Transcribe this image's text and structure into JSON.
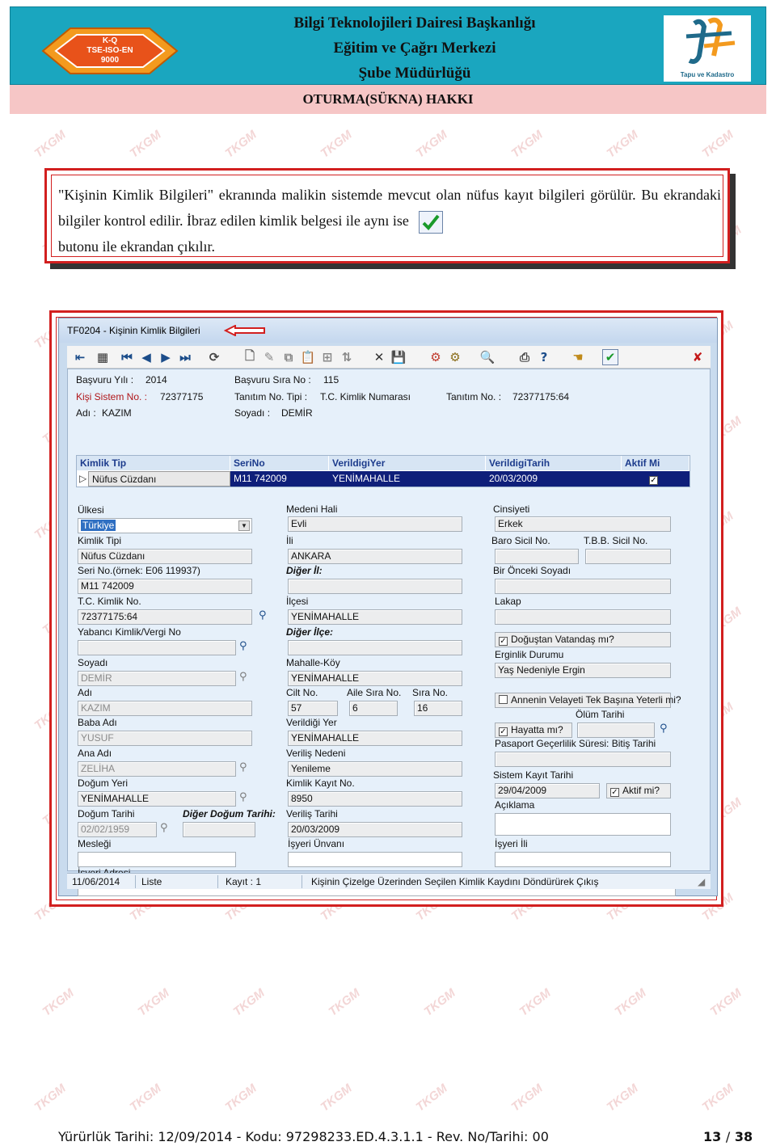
{
  "header": {
    "logo_lines": [
      "K-Q",
      "TSE-ISO-EN",
      "9000"
    ],
    "title_lines": [
      "Bilgi Teknolojileri Dairesi Başkanlığı",
      "Eğitim ve Çağrı Merkezi",
      "Şube Müdürlüğü"
    ],
    "tk_logo_caption": "Tapu ve Kadastro",
    "section_title": "OTURMA(SÜKNA) HAKKI"
  },
  "watermark_text": "TKGM",
  "info": {
    "text_before": "\"Kişinin Kimlik Bilgileri\" ekranında malikin sistemde mevcut olan nüfus kayıt bilgileri görülür. Bu ekrandaki bilgiler kontrol edilir. İbraz edilen kimlik belgesi ile aynı ise",
    "text_after": "butonu ile ekrandan çıkılır."
  },
  "window": {
    "title": "TF0204 - Kişinin Kimlik Bilgileri",
    "summary": {
      "basvuru_yili_label": "Başvuru Yılı :",
      "basvuru_yili": "2014",
      "basvuru_sira_label": "Başvuru Sıra No :",
      "basvuru_sira": "115",
      "kisi_sistem_label": "Kişi Sistem No. :",
      "kisi_sistem": "72377175",
      "tanitim_tipi_label": "Tanıtım No. Tipi :",
      "tanitim_tipi": "T.C. Kimlik Numarası",
      "tanitim_no_label": "Tanıtım No. :",
      "tanitim_no": "72377175:64",
      "adi_label": "Adı :",
      "adi": "KAZIM",
      "soyadi_label": "Soyadı :",
      "soyadi": "DEMİR"
    },
    "grid": {
      "headers": [
        "Kimlik Tip",
        "SeriNo",
        "VerildigiYer",
        "VerildigiTarih",
        "Aktif Mi"
      ],
      "row": [
        "Nüfus Cüzdanı",
        "M11 742009",
        "YENİMAHALLE",
        "20/03/2009",
        "✓"
      ]
    },
    "form": {
      "ulkesi_label": "Ülkesi",
      "ulkesi": "Türkiye",
      "kimlik_tipi_label": "Kimlik Tipi",
      "kimlik_tipi": "Nüfus Cüzdanı",
      "seri_no_label": "Seri No.(örnek: E06 119937)",
      "seri_no": "M11 742009",
      "tc_label": "T.C. Kimlik No.",
      "tc": "72377175:64",
      "yabanci_label": "Yabancı Kimlik/Vergi No",
      "yabanci": "",
      "soyadi_label": "Soyadı",
      "soyadi": "DEMİR",
      "adi_label": "Adı",
      "adi": "KAZIM",
      "baba_label": "Baba Adı",
      "baba": "YUSUF",
      "ana_label": "Ana Adı",
      "ana": "ZELİHA",
      "dogum_yeri_label": "Doğum Yeri",
      "dogum_yeri": "YENİMAHALLE",
      "dogum_tarihi_label": "Doğum Tarihi",
      "dogum_tarihi": "02/02/1959",
      "diger_dogum_label": "Diğer Doğum Tarihi:",
      "diger_dogum": "",
      "meslegi_label": "Mesleği",
      "meslegi": "",
      "isyeri_adresi_label": "İşyeri Adresi",
      "isyeri_adresi": "",
      "medeni_label": "Medeni Hali",
      "medeni": "Evli",
      "ili_label": "İli",
      "ili": "ANKARA",
      "diger_il_label": "Diğer İl:",
      "diger_il": "",
      "ilcesi_label": "İlçesi",
      "ilcesi": "YENİMAHALLE",
      "diger_ilce_label": "Diğer İlçe:",
      "diger_ilce": "",
      "mahalle_label": "Mahalle-Köy",
      "mahalle": "YENİMAHALLE",
      "cilt_label": "Cilt No.",
      "cilt": "57",
      "aile_label": "Aile Sıra No.",
      "aile": "6",
      "sira_label": "Sıra No.",
      "sira": "16",
      "verildigi_yer_label": "Verildiği Yer",
      "verildigi_yer": "YENİMAHALLE",
      "verilis_nedeni_label": "Veriliş Nedeni",
      "verilis_nedeni": "Yenileme",
      "kimlik_kayit_label": "Kimlik Kayıt No.",
      "kimlik_kayit": "8950",
      "verilis_tarihi_label": "Veriliş Tarihi",
      "verilis_tarihi": "20/03/2009",
      "isyeri_unvani_label": "İşyeri Ünvanı",
      "isyeri_unvani": "",
      "cinsiyeti_label": "Cinsiyeti",
      "cinsiyeti": "Erkek",
      "baro_label": "Baro Sicil No.",
      "baro": "",
      "tbb_label": "T.B.B. Sicil No.",
      "tbb": "",
      "onceki_soyadi_label": "Bir Önceki Soyadı",
      "onceki_soyadi": "",
      "lakap_label": "Lakap",
      "lakap": "",
      "dogustan_label": "Doğuştan Vatandaş mı?",
      "erginlik_label": "Erginlik Durumu",
      "erginlik": "Yaş Nedeniyle Ergin",
      "velayet_label": "Annenin Velayeti Tek Başına Yeterli mi?",
      "hayatta_label": "Hayatta mı?",
      "olum_label": "Ölüm Tarihi",
      "olum": "",
      "pasaport_label": "Pasaport Geçerlilik Süresi: Bitiş Tarihi",
      "pasaport": "",
      "sistem_kayit_label": "Sistem Kayıt Tarihi",
      "sistem_kayit": "29/04/2009",
      "aktif_label": "Aktif mi?",
      "aciklama_label": "Açıklama",
      "aciklama": "",
      "isyeri_ili_label": "İşyeri İli",
      "isyeri_ili": ""
    },
    "status": {
      "date": "11/06/2014",
      "mode": "Liste",
      "record": "Kayıt : 1",
      "message": "Kişinin Çizelge Üzerinden Seçilen Kimlik Kaydını Döndürürek Çıkış"
    }
  },
  "footer": {
    "text": "Yürürlük Tarihi: 12/09/2014  -  Kodu: 97298233.ED.4.3.1.1  -  Rev. No/Tarihi: 00",
    "page_current": "13",
    "page_sep": "/",
    "page_total": "38"
  },
  "colors": {
    "header_bg": "#1aa6bf",
    "section_bg": "#f6c6c6",
    "frame_red": "#d21f1f",
    "window_bg": "#c9dbee",
    "grid_selected": "#0f1f7a"
  }
}
